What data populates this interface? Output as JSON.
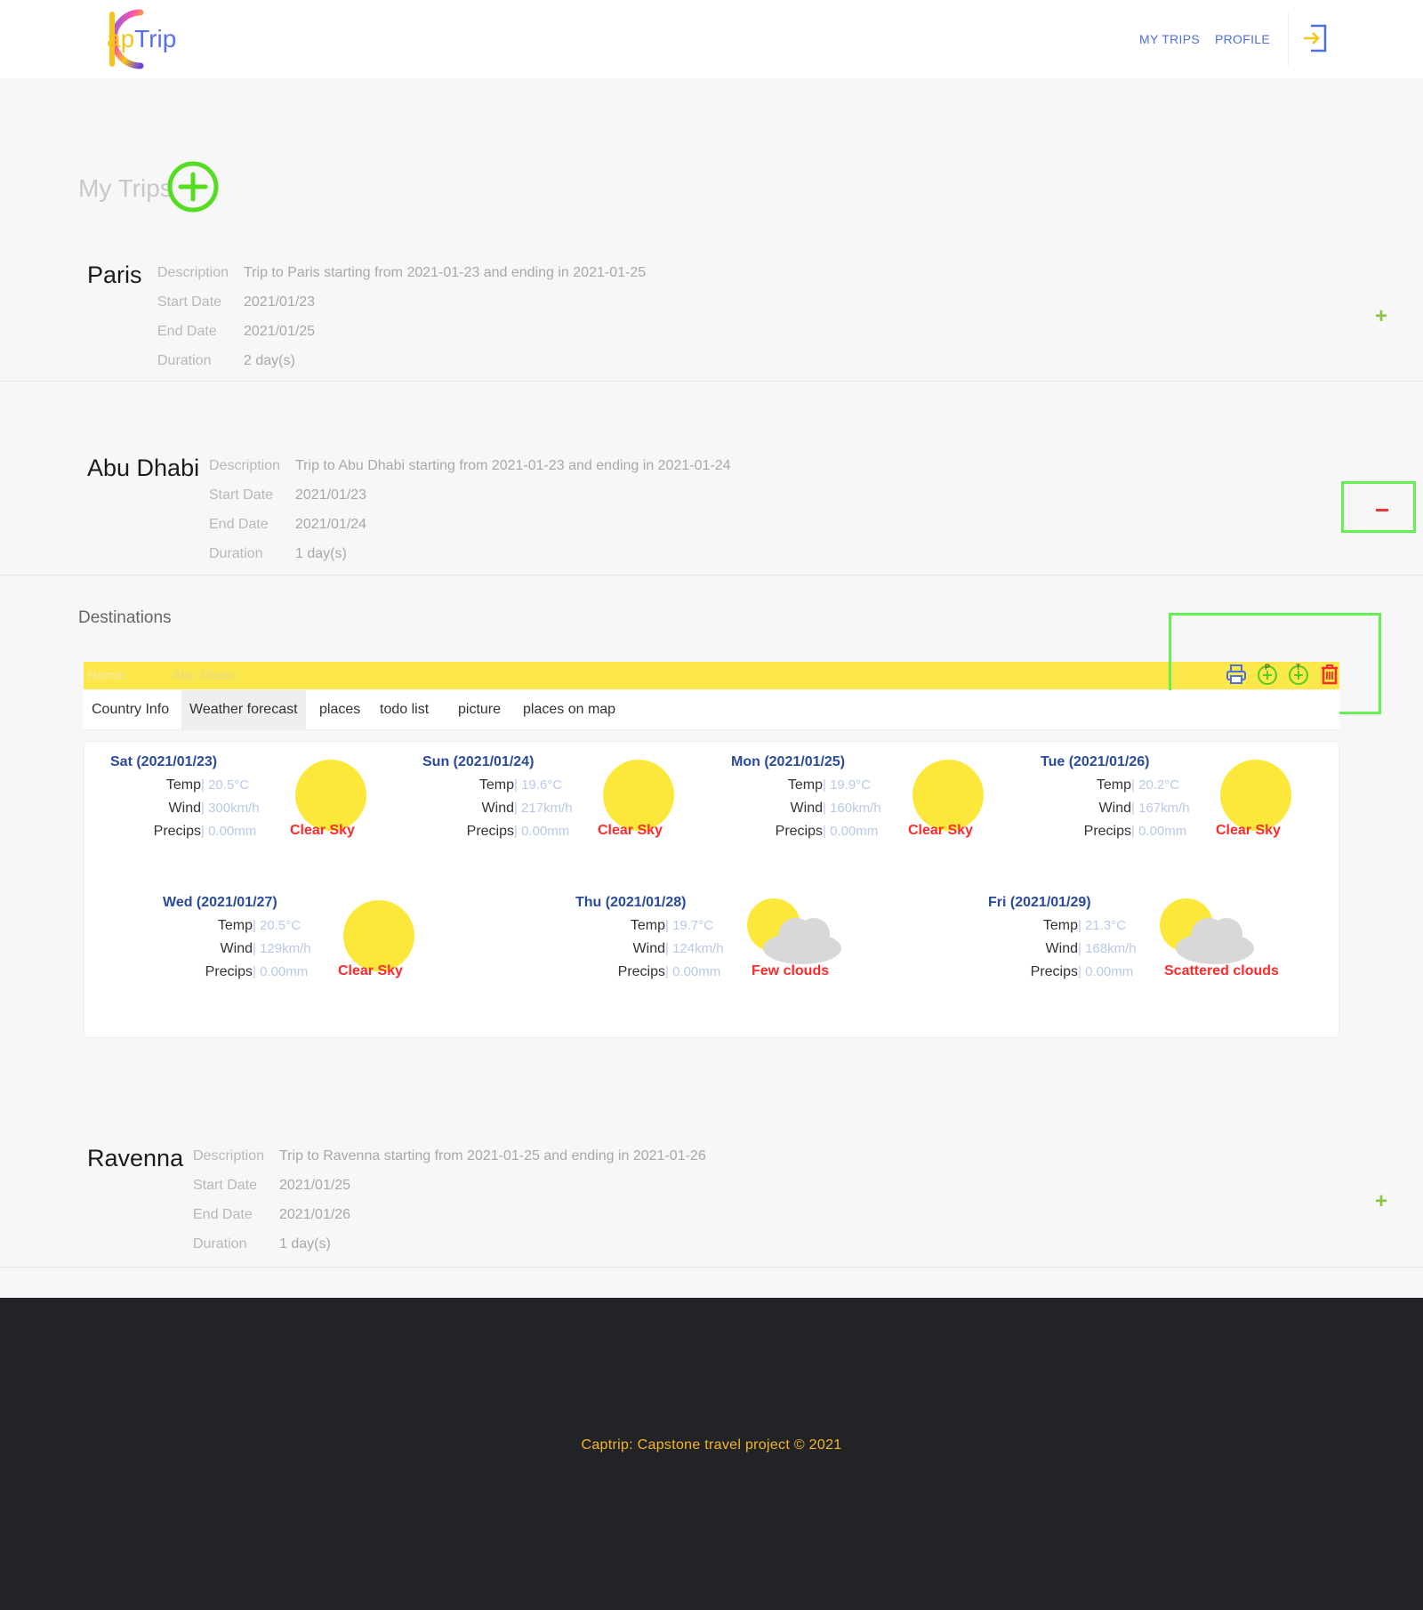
{
  "header": {
    "logo_text_a": "ap",
    "logo_text_b": "Trip",
    "nav": [
      "MY TRIPS",
      "PROFILE"
    ],
    "login_icon": "sign-in-icon"
  },
  "page": {
    "title": "My Trips",
    "add_icon": "plus-circle-icon"
  },
  "trips": [
    {
      "name": "Paris",
      "description_label": "Description",
      "description": "Trip to Paris starting from 2021-01-23 and ending in 2021-01-25",
      "start_label": "Start Date",
      "start": "2021/01/23",
      "end_label": "End Date",
      "end": "2021/01/25",
      "duration_label": "Duration",
      "duration": "2 day(s)",
      "toggle": "+"
    },
    {
      "name": "Abu Dhabi",
      "description_label": "Description",
      "description": "Trip to Abu Dhabi starting from 2021-01-23 and ending in 2021-01-24",
      "start_label": "Start Date",
      "start": "2021/01/23",
      "end_label": "End Date",
      "end": "2021/01/24",
      "duration_label": "Duration",
      "duration": "1 day(s)",
      "toggle": "-"
    },
    {
      "name": "Ravenna",
      "description_label": "Description",
      "description": "Trip to Ravenna starting from 2021-01-25 and ending in 2021-01-26",
      "start_label": "Start Date",
      "start": "2021/01/25",
      "end_label": "End Date",
      "end": "2021/01/26",
      "duration_label": "Duration",
      "duration": "1 day(s)",
      "toggle": "+"
    }
  ],
  "destinations": {
    "title": "Destinations",
    "name_label": "Name:",
    "name_value": "Abu Dhabi",
    "actions": [
      "print-icon",
      "add-place-icon",
      "add-todo-icon",
      "trash-icon"
    ],
    "action_letters": [
      "P",
      "T"
    ],
    "tabs": [
      "Country Info",
      "Weather forecast",
      "places",
      "todo list",
      "picture",
      "places on map"
    ],
    "active_tab": "Weather forecast"
  },
  "weather": {
    "labels": {
      "temp": "Temp",
      "wind": "Wind",
      "precips": "Precips"
    },
    "days": [
      {
        "title": "Sat (2021/01/23)",
        "temp": "| 20.5°C",
        "wind": "| 300km/h",
        "precips": "| 0.00mm",
        "condition": "Clear Sky",
        "icon": "sun-icon"
      },
      {
        "title": "Sun (2021/01/24)",
        "temp": "| 19.6°C",
        "wind": "| 217km/h",
        "precips": "| 0.00mm",
        "condition": "Clear Sky",
        "icon": "sun-icon"
      },
      {
        "title": "Mon (2021/01/25)",
        "temp": "| 19.9°C",
        "wind": "| 160km/h",
        "precips": "| 0.00mm",
        "condition": "Clear Sky",
        "icon": "sun-icon"
      },
      {
        "title": "Tue (2021/01/26)",
        "temp": "| 20.2°C",
        "wind": "| 167km/h",
        "precips": "| 0.00mm",
        "condition": "Clear Sky",
        "icon": "sun-icon"
      },
      {
        "title": "Wed (2021/01/27)",
        "temp": "| 20.5°C",
        "wind": "| 129km/h",
        "precips": "| 0.00mm",
        "condition": "Clear Sky",
        "icon": "sun-icon"
      },
      {
        "title": "Thu (2021/01/28)",
        "temp": "| 19.7°C",
        "wind": "| 124km/h",
        "precips": "| 0.00mm",
        "condition": "Few clouds",
        "icon": "sun-cloud-icon"
      },
      {
        "title": "Fri (2021/01/29)",
        "temp": "| 21.3°C",
        "wind": "| 168km/h",
        "precips": "| 0.00mm",
        "condition": "Scattered clouds",
        "icon": "sun-cloud-icon"
      }
    ]
  },
  "footer": {
    "text": "Captrip: Capstone travel project © 2021"
  },
  "colors": {
    "accent_blue": "#4d6fe0",
    "accent_yellow": "#fce84a",
    "accent_green": "#66ee55",
    "danger_red": "#ff2a2a",
    "footer_bg": "#212327",
    "footer_text": "#f5b81c"
  }
}
